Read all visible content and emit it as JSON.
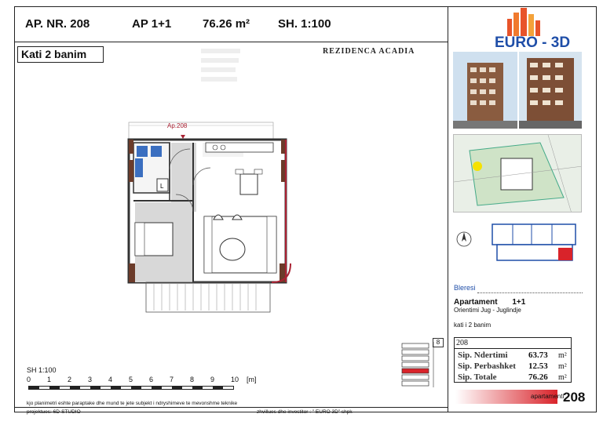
{
  "header": {
    "ap_nr": "AP. NR. 208",
    "ap_type": "AP 1+1",
    "area": "76.26 m²",
    "scale": "SH. 1:100"
  },
  "floor_label": "Kati 2 banim",
  "project_name": "REZIDENCA ACADIA",
  "brand": {
    "name": "EURO - 3D",
    "color": "#1f4ea8",
    "accent": "#e8542a"
  },
  "plan": {
    "unit_tag": "Ap.208",
    "accent": "#d9232a"
  },
  "info": {
    "buyer_label": "Bleresi",
    "apartment_label": "Apartament",
    "apartment_type": "1+1",
    "orientation": "Orientimi  Jug - Juglindje",
    "floor": "kati i 2 banim",
    "floor_no": "8",
    "apt_no": "208"
  },
  "areas": [
    {
      "label": "Sip. Ndertimi",
      "value": "63.73",
      "unit": "m²"
    },
    {
      "label": "Sip. Perbashket",
      "value": "12.53",
      "unit": "m²"
    },
    {
      "label": "Sip. Totale",
      "value": "76.26",
      "unit": "m²"
    }
  ],
  "scale_bar": {
    "label": "SH 1:100",
    "ticks": [
      "0",
      "1",
      "2",
      "3",
      "4",
      "5",
      "6",
      "7",
      "8",
      "9",
      "10"
    ],
    "unit": "[m]"
  },
  "footer": {
    "note": "kjo planimetri eshte paraptake dhe mund te jete subjekt i ndryshimeve te mevonshme teknike",
    "projektues": "projektues:   6D-STUDIO",
    "investitor": "zhvillues dhe investitor :  \" EURO 3D\" shpk",
    "apt_word": "apartamenti",
    "apt_num": "208"
  }
}
